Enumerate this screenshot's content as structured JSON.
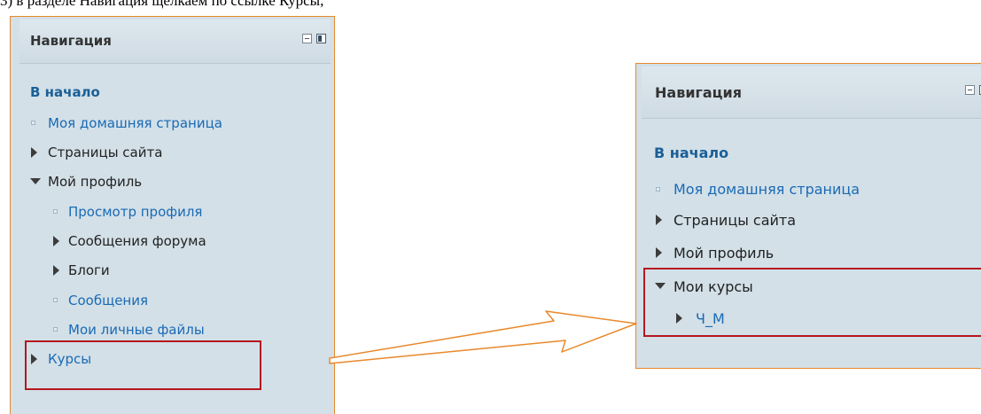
{
  "caption": "3) в разделе Навигация щелкаем по ссылке Курсы,",
  "left": {
    "title": "Навигация",
    "items": [
      {
        "label": "В начало",
        "kind": "home"
      },
      {
        "label": "Моя домашняя страница",
        "kind": "leaf-link"
      },
      {
        "label": "Страницы сайта",
        "kind": "collapsed"
      },
      {
        "label": "Мой профиль",
        "kind": "expanded"
      },
      {
        "label": "Просмотр профиля",
        "kind": "leaf-link"
      },
      {
        "label": "Сообщения форума",
        "kind": "collapsed"
      },
      {
        "label": "Блоги",
        "kind": "collapsed"
      },
      {
        "label": "Сообщения",
        "kind": "leaf-link"
      },
      {
        "label": "Мои личные файлы",
        "kind": "leaf-link"
      },
      {
        "label": "Курсы",
        "kind": "collapsed"
      }
    ]
  },
  "right": {
    "title": "Навигация",
    "items": [
      {
        "label": "В начало",
        "kind": "home"
      },
      {
        "label": "Моя домашняя страница",
        "kind": "leaf-link"
      },
      {
        "label": "Страницы сайта",
        "kind": "collapsed"
      },
      {
        "label": "Мой профиль",
        "kind": "collapsed"
      },
      {
        "label": "Мои курсы",
        "kind": "expanded"
      },
      {
        "label": "Ч_М",
        "kind": "collapsed-link"
      }
    ]
  },
  "colors": {
    "panel_bg": "#d3e0e8",
    "panel_border": "#e8892b",
    "highlight": "#b5171f",
    "link": "#1a6ab4"
  }
}
